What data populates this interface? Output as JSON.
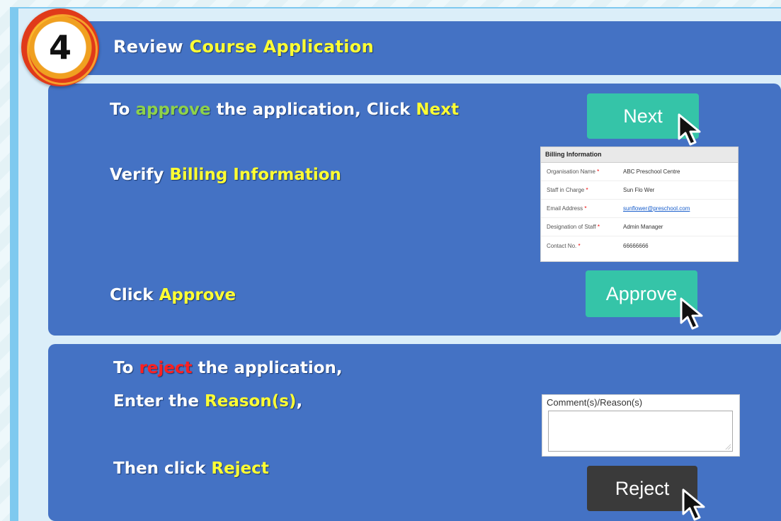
{
  "step": {
    "number": "4",
    "title_prefix": "Review ",
    "title_highlight": "Course Application"
  },
  "approve_section": {
    "line1": {
      "t1": "To ",
      "t2": "approve",
      "t3": " the application, Click ",
      "t4": "Next"
    },
    "line2": {
      "t1": "Verify ",
      "t2": "Billing Information"
    },
    "line3": {
      "t1": "Click ",
      "t2": "Approve"
    },
    "next_button": "Next",
    "approve_button": "Approve"
  },
  "billing": {
    "heading": "Billing Information",
    "rows": [
      {
        "label": "Organisation Name",
        "value": "ABC Preschool Centre"
      },
      {
        "label": "Staff in Charge",
        "value": "Sun Flo Wer"
      },
      {
        "label": "Email Address",
        "value": "sunflower@preschool.com"
      },
      {
        "label": "Designation of Staff",
        "value": "Admin Manager"
      },
      {
        "label": "Contact No.",
        "value": "66666666"
      }
    ],
    "required_mark": "*"
  },
  "reject_section": {
    "line1": {
      "t1": "To ",
      "t2": "reject",
      "t3": " the application,"
    },
    "line2": {
      "t1": "Enter the ",
      "t2": "Reason(s)",
      "t3": ","
    },
    "line3": {
      "t1": "Then click ",
      "t2": "Reject"
    },
    "comment_label": "Comment(s)/Reason(s)",
    "comment_value": "",
    "reject_button": "Reject"
  },
  "colors": {
    "panel": "#4472c4",
    "highlight": "#ffff33",
    "approve_word": "#8ed24a",
    "reject_word": "#ff2020",
    "green_button": "#35c4a8",
    "dark_button": "#3a3a3a"
  },
  "icons": [
    "mouse-cursor-icon"
  ]
}
